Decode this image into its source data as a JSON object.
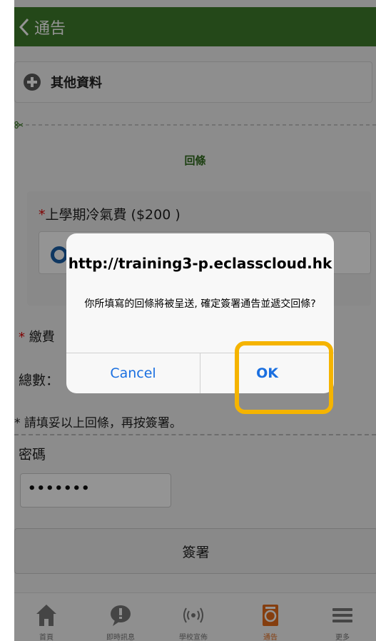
{
  "header": {
    "title": "通告"
  },
  "section": {
    "label": "其他資料"
  },
  "reply": {
    "title": "回條"
  },
  "question": {
    "star": "*",
    "label": "上學期冷氣費 ($200 )"
  },
  "pay": {
    "star": "*",
    "label": "繳費"
  },
  "total": {
    "label": "總數："
  },
  "notice": {
    "text": "* 請填妥以上回條，再按簽署。"
  },
  "password": {
    "label": "密碼",
    "value": "•••••••"
  },
  "sign_button": {
    "label": "簽署"
  },
  "tabbar": {
    "items": [
      {
        "label": "首頁",
        "icon": "home-icon"
      },
      {
        "label": "即時訊息",
        "icon": "message-icon"
      },
      {
        "label": "學校宣佈",
        "icon": "broadcast-icon"
      },
      {
        "label": "通告",
        "icon": "notice-icon",
        "active": true
      },
      {
        "label": "更多",
        "icon": "menu-icon"
      }
    ]
  },
  "dialog": {
    "title": "http://training3-p.eclasscloud.hk",
    "message": "你所填寫的回條將被呈送, 確定簽署通告並遞交回條?",
    "cancel_label": "Cancel",
    "ok_label": "OK"
  },
  "colors": {
    "header_green": "#3f7d2b",
    "highlight": "#f5b400",
    "ios_blue": "#1a6fe0",
    "active_tab": "#e56c1b"
  }
}
